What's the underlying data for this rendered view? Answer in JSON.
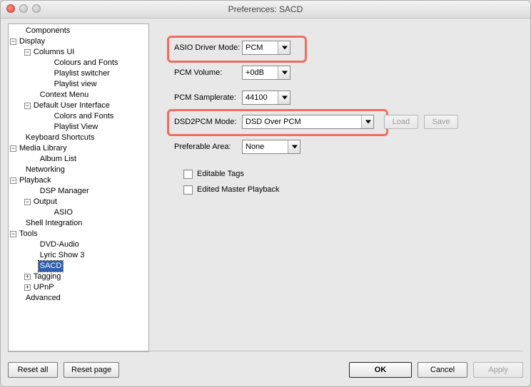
{
  "window": {
    "title": "Preferences: SACD"
  },
  "tree": {
    "components": "Components",
    "display": "Display",
    "columns_ui": "Columns UI",
    "colours_fonts": "Colours and Fonts",
    "playlist_switcher": "Playlist switcher",
    "playlist_view_lc": "Playlist view",
    "context_menu": "Context Menu",
    "default_ui": "Default User Interface",
    "colors_fonts": "Colors and Fonts",
    "playlist_view": "Playlist View",
    "keyboard_shortcuts": "Keyboard Shortcuts",
    "media_library": "Media Library",
    "album_list": "Album List",
    "networking": "Networking",
    "playback": "Playback",
    "dsp_manager": "DSP Manager",
    "output": "Output",
    "asio": "ASIO",
    "shell_integration": "Shell Integration",
    "tools": "Tools",
    "dvd_audio": "DVD-Audio",
    "lyric_show": "Lyric Show 3",
    "sacd": "SACD",
    "tagging": "Tagging",
    "upnp": "UPnP",
    "advanced": "Advanced"
  },
  "form": {
    "asio_driver_mode": {
      "label": "ASIO Driver Mode:",
      "value": "PCM"
    },
    "pcm_volume": {
      "label": "PCM Volume:",
      "value": "+0dB"
    },
    "pcm_samplerate": {
      "label": "PCM Samplerate:",
      "value": "44100"
    },
    "dsd2pcm_mode": {
      "label": "DSD2PCM Mode:",
      "value": "DSD Over PCM",
      "load": "Load",
      "save": "Save"
    },
    "preferable_area": {
      "label": "Preferable Area:",
      "value": "None"
    },
    "editable_tags": {
      "label": "Editable Tags"
    },
    "edited_master": {
      "label": "Edited Master Playback"
    }
  },
  "footer": {
    "reset_all": "Reset all",
    "reset_page": "Reset page",
    "ok": "OK",
    "cancel": "Cancel",
    "apply": "Apply"
  },
  "colors": {
    "highlight": "#EE6E62",
    "selection": "#2E5FAC"
  }
}
